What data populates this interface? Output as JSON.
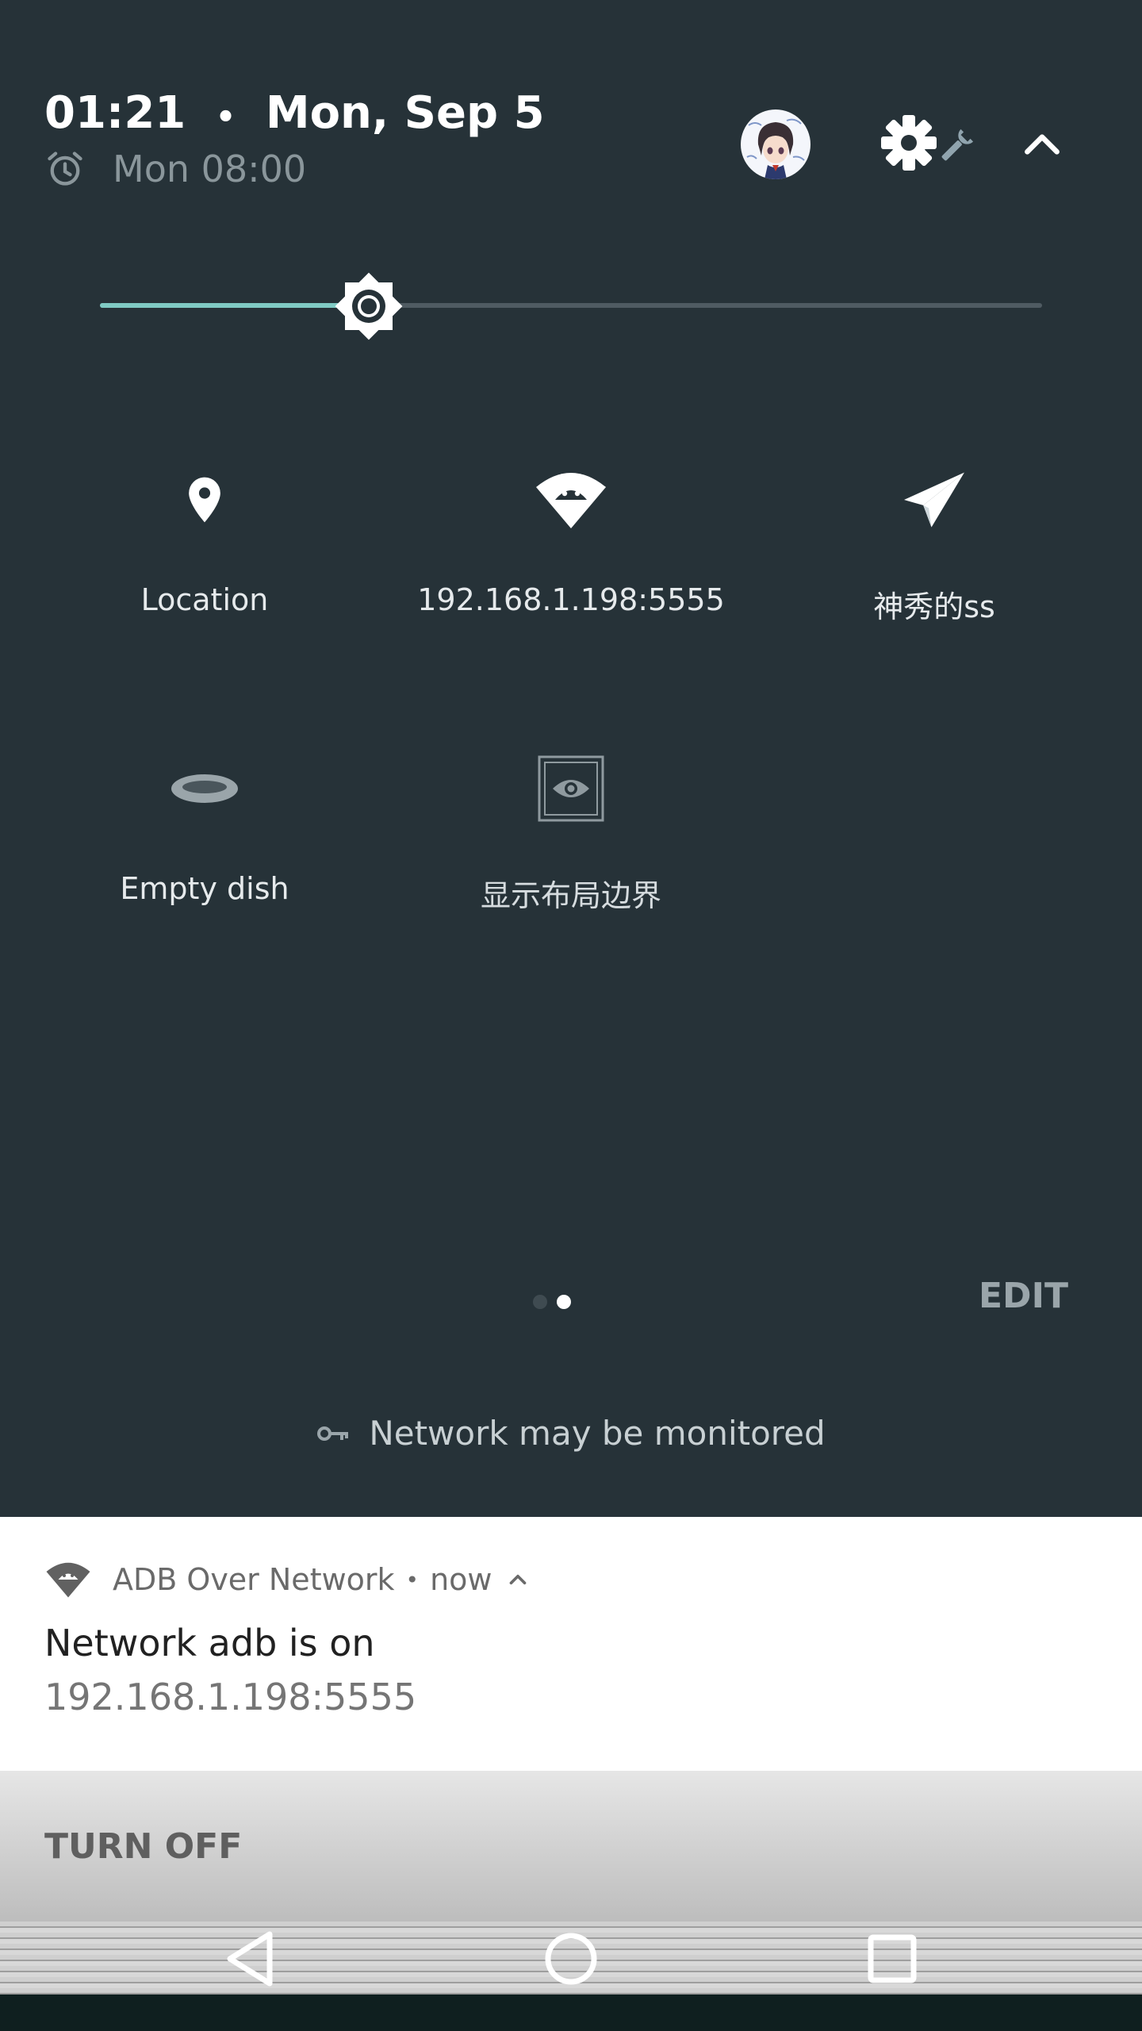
{
  "header": {
    "time": "01:21",
    "separator": "•",
    "date": "Mon, Sep 5",
    "alarm": "Mon 08:00"
  },
  "brightness": {
    "level": 0.285
  },
  "tiles": [
    {
      "label": "Location",
      "icon": "location-pin-icon"
    },
    {
      "label": "192.168.1.198:5555",
      "icon": "adb-wifi-icon"
    },
    {
      "label": "神秀的ss",
      "icon": "paper-plane-icon"
    },
    {
      "label": "Empty dish",
      "icon": "empty-dish-icon"
    },
    {
      "label": "显示布局边界",
      "icon": "layout-bounds-icon"
    }
  ],
  "pager": {
    "pages": 2,
    "current": 2
  },
  "edit_label": "EDIT",
  "network_warning": "Network may be monitored",
  "notification": {
    "app": "ADB Over Network",
    "time": "now",
    "title": "Network adb is on",
    "text": "192.168.1.198:5555",
    "action": "TURN OFF"
  },
  "colors": {
    "panel_bg": "#263238",
    "accent": "#80cbc4",
    "notification_bg": "#ffffff"
  }
}
